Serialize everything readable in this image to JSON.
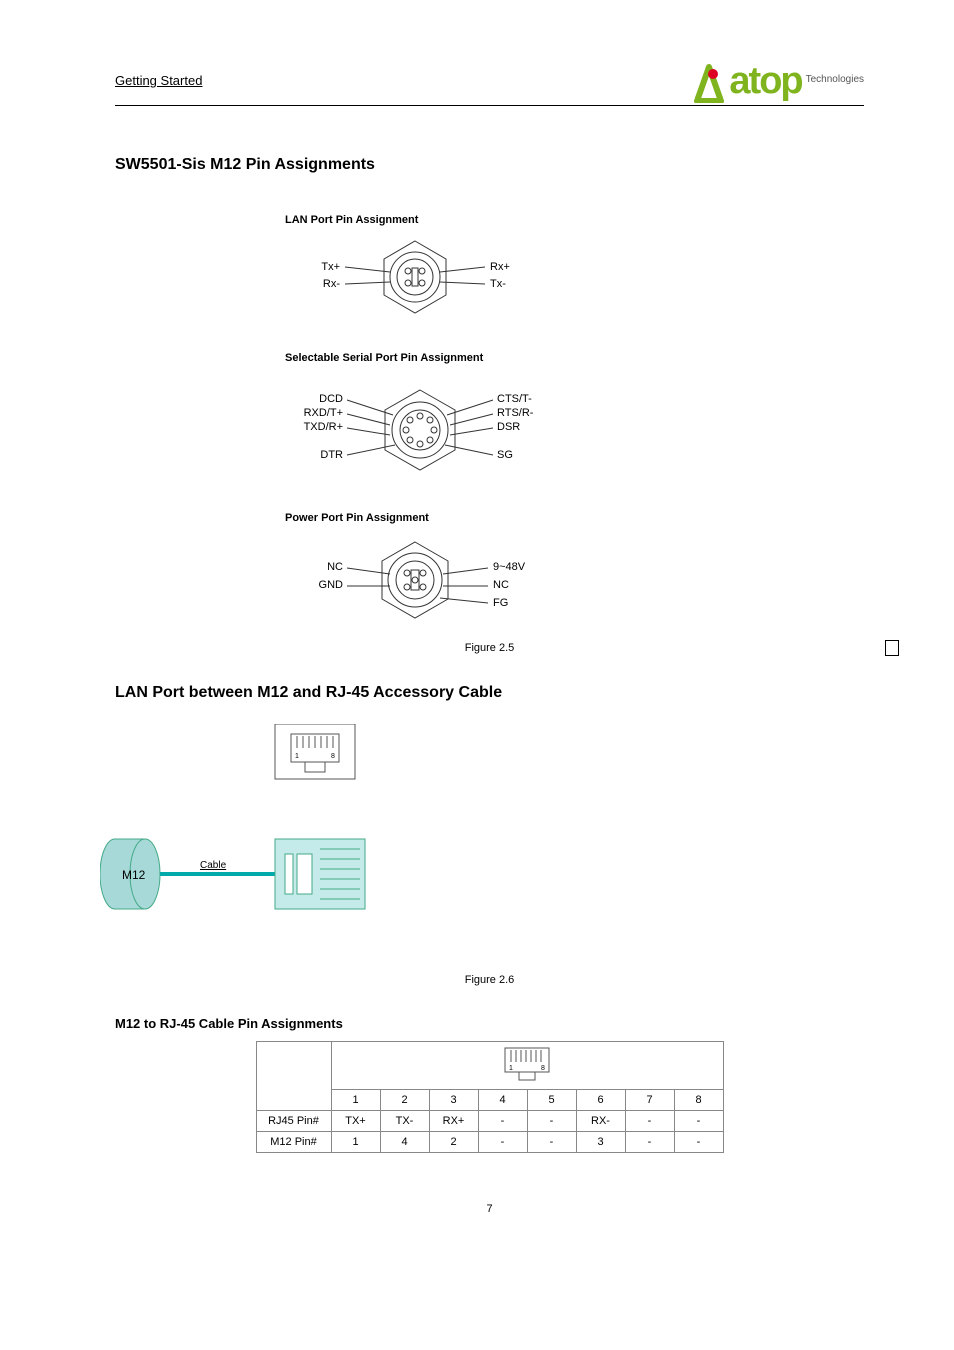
{
  "header": {
    "doc_type": "Getting Started",
    "logo_text": "atop",
    "logo_sub": "Technologies"
  },
  "section1": {
    "heading": "SW5501-Sis M12 Pin Assignments",
    "lan": {
      "title": "LAN Port Pin Assignment",
      "tx_plus": "Tx+",
      "rx_minus": "Rx-",
      "rx_plus": "Rx+",
      "tx_minus": "Tx-"
    },
    "serial": {
      "title": "Selectable Serial Port Pin Assignment",
      "dcd": "DCD",
      "rxd": "RXD/T+",
      "txd": "TXD/R+",
      "dtr": "DTR",
      "cts": "CTS/T-",
      "rts": "RTS/R-",
      "dsr": "DSR",
      "sg": "SG"
    },
    "power": {
      "title": "Power Port Pin Assignment",
      "nc1": "NC",
      "gnd": "GND",
      "v": "9~48V",
      "nc2": "NC",
      "fg": "FG"
    },
    "caption": "Figure 2.5"
  },
  "section2": {
    "heading": "LAN Port between M12 and RJ-45 Accessory Cable",
    "m12_label": "M12",
    "cable_label": "Cable",
    "caption": "Figure 2.6",
    "table_heading": "M12 to RJ-45 Cable Pin Assignments",
    "cols": {
      "c1": "1",
      "c2": "2",
      "c3": "3",
      "c4": "4",
      "c5": "5",
      "c6": "6",
      "c7": "7",
      "c8": "8"
    },
    "rows": {
      "label1": "RJ45 Pin#",
      "r1c1": "TX+",
      "r1c2": "TX-",
      "r1c3": "RX+",
      "r1c4": "-",
      "r1c5": "-",
      "r1c6": "RX-",
      "r1c7": "-",
      "r1c8": "-",
      "label2": "M12 Pin#",
      "r2c1": "1",
      "r2c2": "4",
      "r2c3": "2",
      "r2c4": "-",
      "r2c5": "-",
      "r2c6": "3",
      "r2c7": "-",
      "r2c8": "-"
    }
  },
  "page_number": "7"
}
